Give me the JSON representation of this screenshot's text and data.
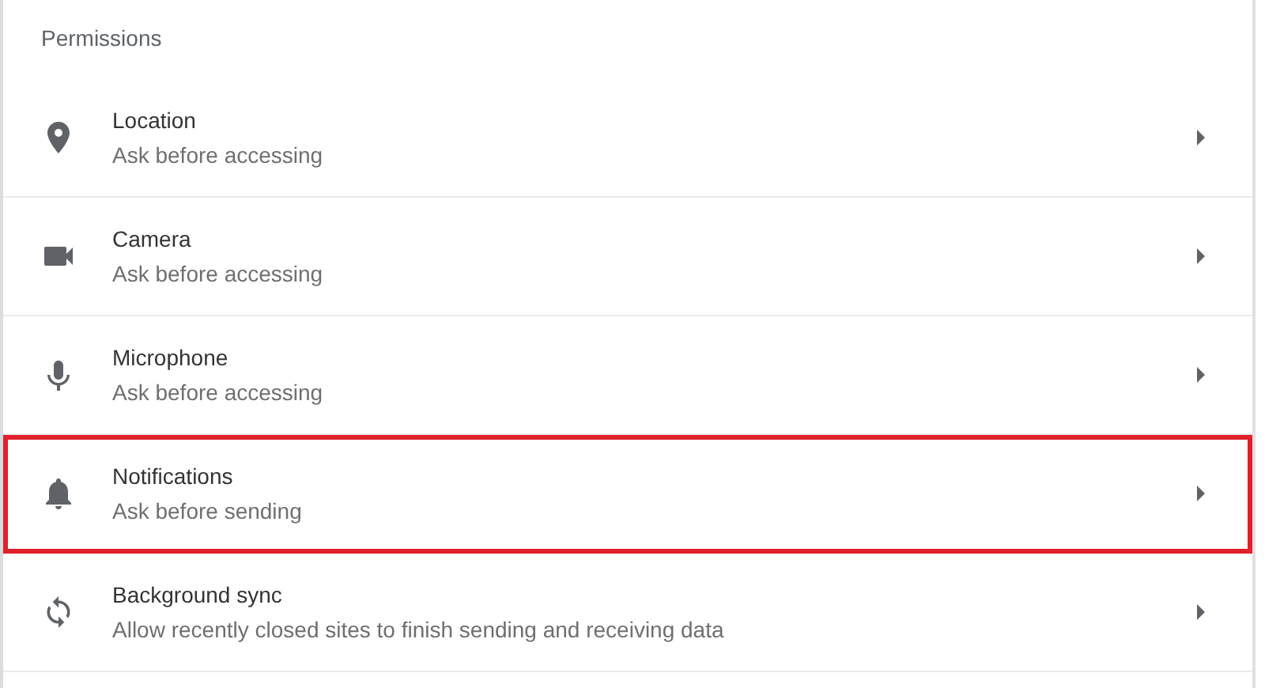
{
  "section": {
    "title": "Permissions"
  },
  "rows": [
    {
      "kind": "location",
      "title": "Location",
      "subtitle": "Ask before accessing",
      "highlighted": false
    },
    {
      "kind": "camera",
      "title": "Camera",
      "subtitle": "Ask before accessing",
      "highlighted": false
    },
    {
      "kind": "microphone",
      "title": "Microphone",
      "subtitle": "Ask before accessing",
      "highlighted": false
    },
    {
      "kind": "notifications",
      "title": "Notifications",
      "subtitle": "Ask before sending",
      "highlighted": true
    },
    {
      "kind": "sync",
      "title": "Background sync",
      "subtitle": "Allow recently closed sites to finish sending and receiving data",
      "highlighted": false
    }
  ]
}
